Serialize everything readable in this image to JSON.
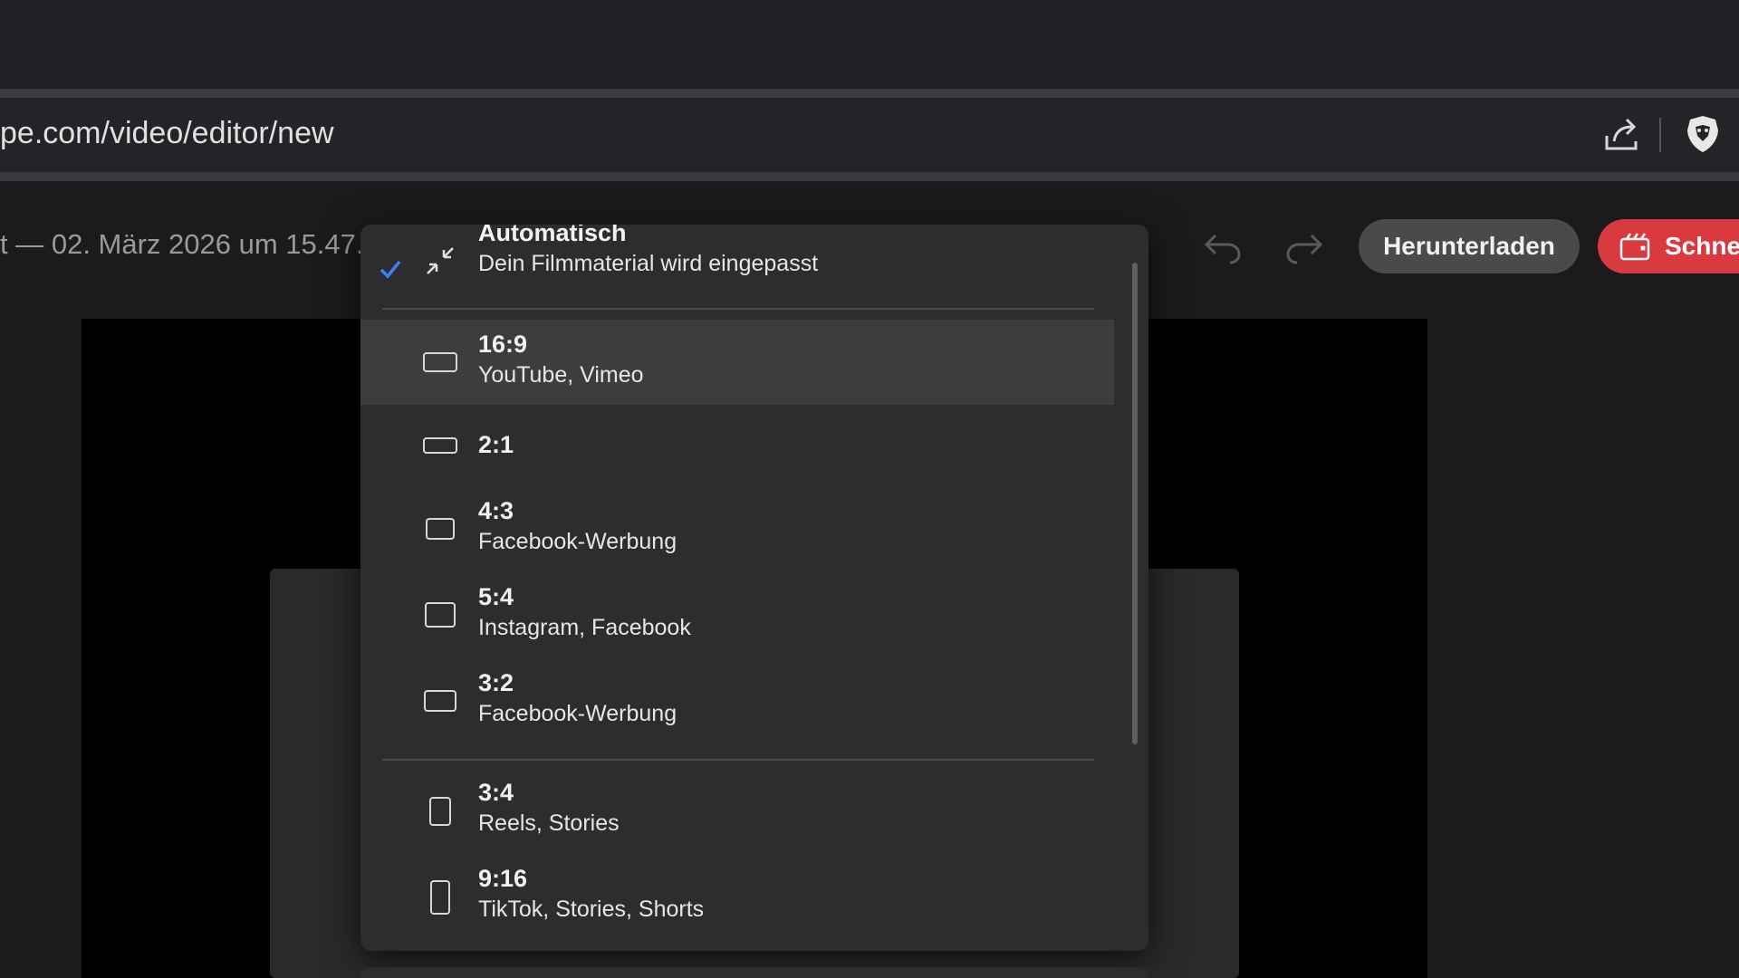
{
  "browser": {
    "url": "pe.com/video/editor/new"
  },
  "app": {
    "project_title": "t — 02. März 2026 um 15.47.1",
    "download_label": "Herunterladen",
    "quick_label": "Schnel"
  },
  "dropdown": {
    "auto": {
      "title": "Automatisch",
      "subtitle": "Dein Filmmaterial wird eingepasst",
      "checked": true
    },
    "items": [
      {
        "ratio": "16:9",
        "subtitle": "YouTube, Vimeo",
        "highlighted": true
      },
      {
        "ratio": "2:1",
        "subtitle": ""
      },
      {
        "ratio": "4:3",
        "subtitle": "Facebook-Werbung"
      },
      {
        "ratio": "5:4",
        "subtitle": "Instagram, Facebook"
      },
      {
        "ratio": "3:2",
        "subtitle": "Facebook-Werbung"
      },
      {
        "ratio": "3:4",
        "subtitle": "Reels, Stories"
      },
      {
        "ratio": "9:16",
        "subtitle": "TikTok, Stories, Shorts"
      }
    ]
  },
  "colors": {
    "check": "#3b82f6",
    "accent_red": "#d93a3f"
  },
  "icons": [
    "share-icon",
    "brave-shield-icon",
    "undo-icon",
    "redo-icon",
    "video-icon",
    "check-icon",
    "shrink-icon",
    "aspect-ratio-icon"
  ]
}
